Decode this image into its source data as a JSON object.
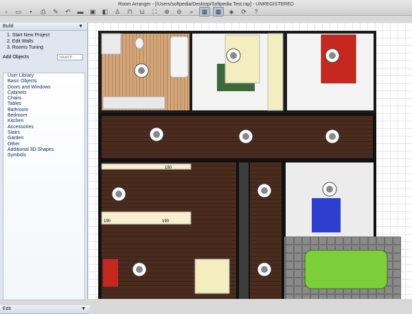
{
  "window": {
    "title": "Room Arranger - [/Users/softpedia/Desktop/Softpedia Test.rap] - UNREGISTERED"
  },
  "sidebar": {
    "build_header": "Build",
    "steps": [
      "1. Start New Project",
      "2. Edit Walls",
      "3. Rooms Tuning"
    ],
    "add_objects_label": "Add Objects",
    "search_placeholder": "Search",
    "categories": [
      "User Library",
      "Basic Objects",
      "Doors and Windows",
      "Cabinets",
      "Chairs",
      "Tables",
      "Bathroom",
      "Bedroom",
      "Kitchen",
      "Accessories",
      "Stairs",
      "Garden",
      "Other",
      "Additional 3D Shapes",
      "Symbols"
    ],
    "edit_header": "Edit"
  },
  "plan": {
    "dims": [
      "190",
      "190",
      "190"
    ]
  },
  "colors": {
    "floor": "#4a2c1e",
    "wall": "#111111",
    "grass": "#2e7d32",
    "car": "#7ccf3a",
    "bed_red": "#c6281f",
    "bed_blue": "#2e3fd0"
  }
}
